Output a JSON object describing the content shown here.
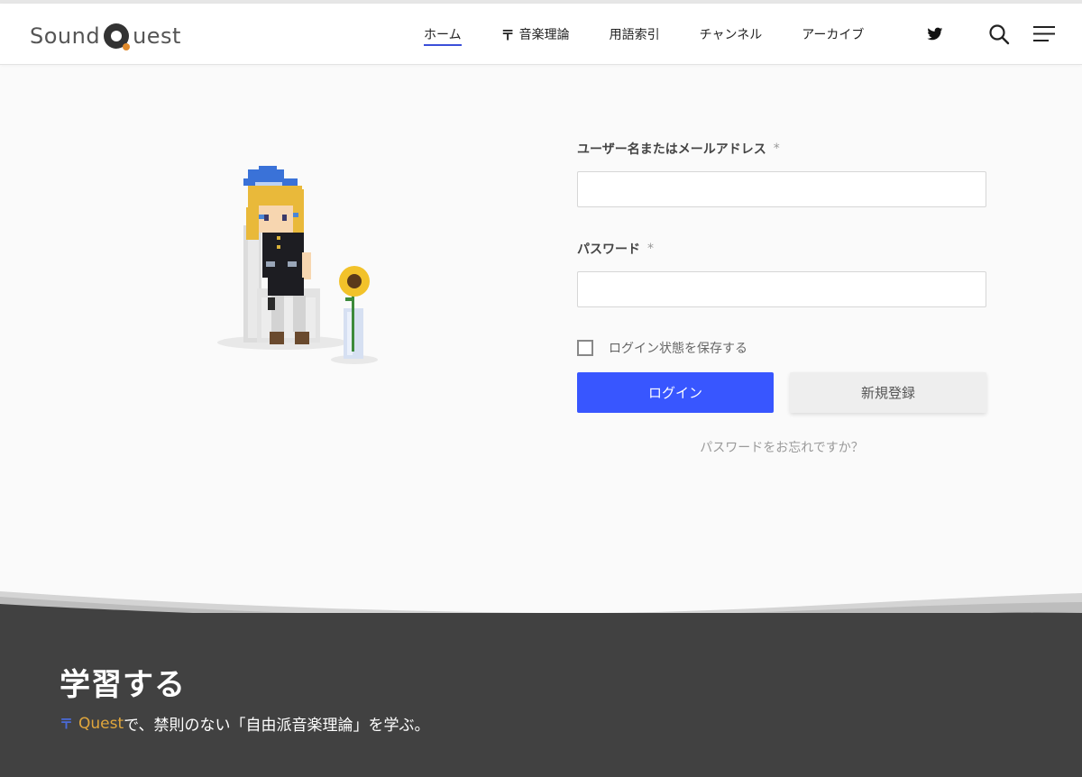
{
  "header": {
    "logo_prefix": "Sound",
    "logo_suffix": "uest",
    "nav": [
      {
        "label": "ホーム",
        "active": true
      },
      {
        "label": "音楽理論",
        "icon": "signpost-icon"
      },
      {
        "label": "用語索引"
      },
      {
        "label": "チャンネル"
      },
      {
        "label": "アーカイブ"
      }
    ],
    "icons": [
      "twitter-icon",
      "search-icon",
      "menu-icon"
    ]
  },
  "login_form": {
    "username_label": "ユーザー名またはメールアドレス",
    "password_label": "パスワード",
    "required_mark": "*",
    "username_value": "",
    "password_value": "",
    "remember_label": "ログイン状態を保存する",
    "remember_checked": false,
    "login_button": "ログイン",
    "register_button": "新規登録",
    "forgot_link": "パスワードをお忘れですか？"
  },
  "footer": {
    "title": "学習する",
    "subtitle_icon": "〒",
    "subtitle_quest": "Quest",
    "subtitle_rest": "で、禁則のない「自由派音楽理論」を学ぶ。"
  },
  "colors": {
    "accent": "#3856ff",
    "nav_underline": "#3b4fd9",
    "footer_bg": "#414141",
    "quest_orange": "#e0a63c",
    "logo_q_dot": "#e08a2c"
  }
}
